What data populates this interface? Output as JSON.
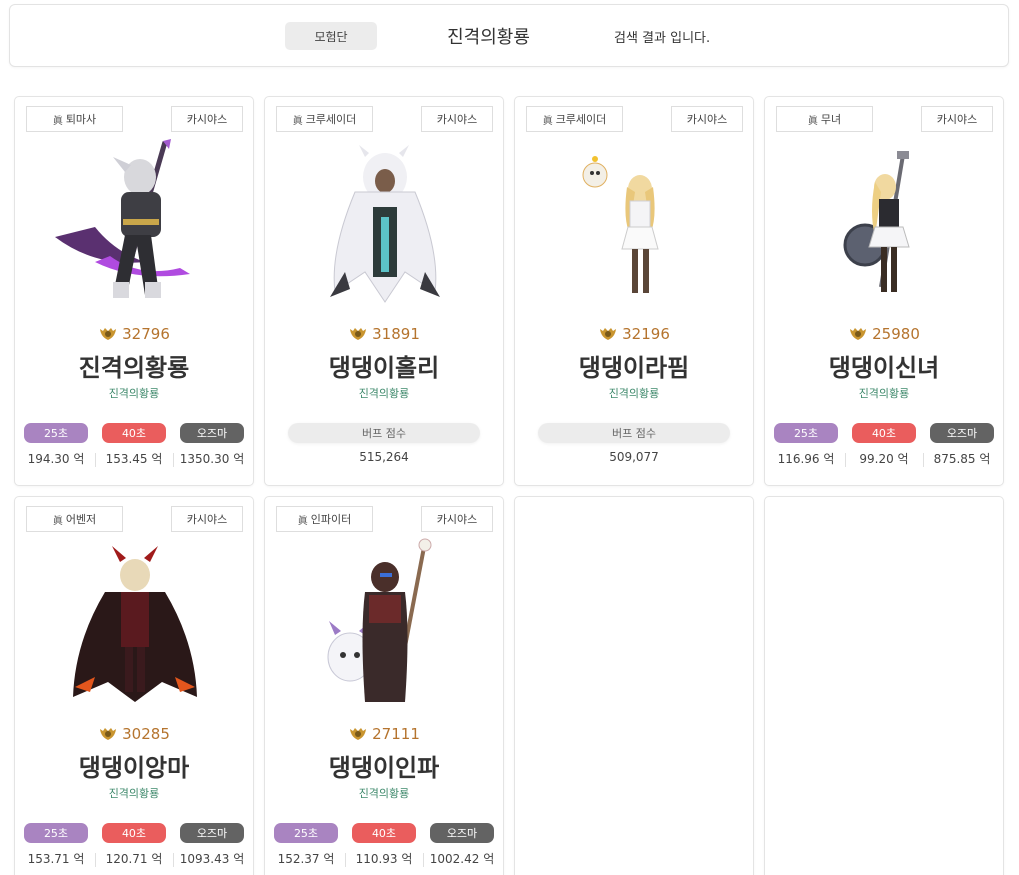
{
  "header": {
    "type_button": "모험단",
    "guild_name": "진격의황룡",
    "result_text": "검색 결과 입니다."
  },
  "cards": [
    {
      "job": "퇴마사",
      "server": "카시야스",
      "fame": "32796",
      "name": "진격의황룡",
      "adventure": "진격의황룡",
      "kind": "dealer",
      "chip25": "25초",
      "chip40": "40초",
      "chipOz": "오즈마",
      "val25": "194.30 억",
      "val40": "153.45 억",
      "valOz": "1350.30 억"
    },
    {
      "job": "크루세이더",
      "server": "카시야스",
      "fame": "31891",
      "name": "댕댕이홀리",
      "adventure": "진격의황룡",
      "kind": "buffer",
      "buff_label": "버프 점수",
      "buff_value": "515,264"
    },
    {
      "job": "크루세이더",
      "server": "카시야스",
      "fame": "32196",
      "name": "댕댕이라핌",
      "adventure": "진격의황룡",
      "kind": "buffer",
      "buff_label": "버프 점수",
      "buff_value": "509,077"
    },
    {
      "job": "무녀",
      "server": "카시야스",
      "fame": "25980",
      "name": "댕댕이신녀",
      "adventure": "진격의황룡",
      "kind": "dealer",
      "chip25": "25초",
      "chip40": "40초",
      "chipOz": "오즈마",
      "val25": "116.96 억",
      "val40": "99.20 억",
      "valOz": "875.85 억"
    },
    {
      "job": "어벤저",
      "server": "카시야스",
      "fame": "30285",
      "name": "댕댕이앙마",
      "adventure": "진격의황룡",
      "kind": "dealer",
      "chip25": "25초",
      "chip40": "40초",
      "chipOz": "오즈마",
      "val25": "153.71 억",
      "val40": "120.71 억",
      "valOz": "1093.43 억"
    },
    {
      "job": "인파이터",
      "server": "카시야스",
      "fame": "27111",
      "name": "댕댕이인파",
      "adventure": "진격의황룡",
      "kind": "dealer",
      "chip25": "25초",
      "chip40": "40초",
      "chipOz": "오즈마",
      "val25": "152.37 억",
      "val40": "110.93 억",
      "valOz": "1002.42 억"
    }
  ],
  "colors": {
    "chip25": "#a984c1",
    "chip40": "#ea5d5d",
    "chipOz": "#636363",
    "fame": "#b5742e",
    "adventure": "#3f8a6c"
  },
  "jin_glyph": "眞"
}
